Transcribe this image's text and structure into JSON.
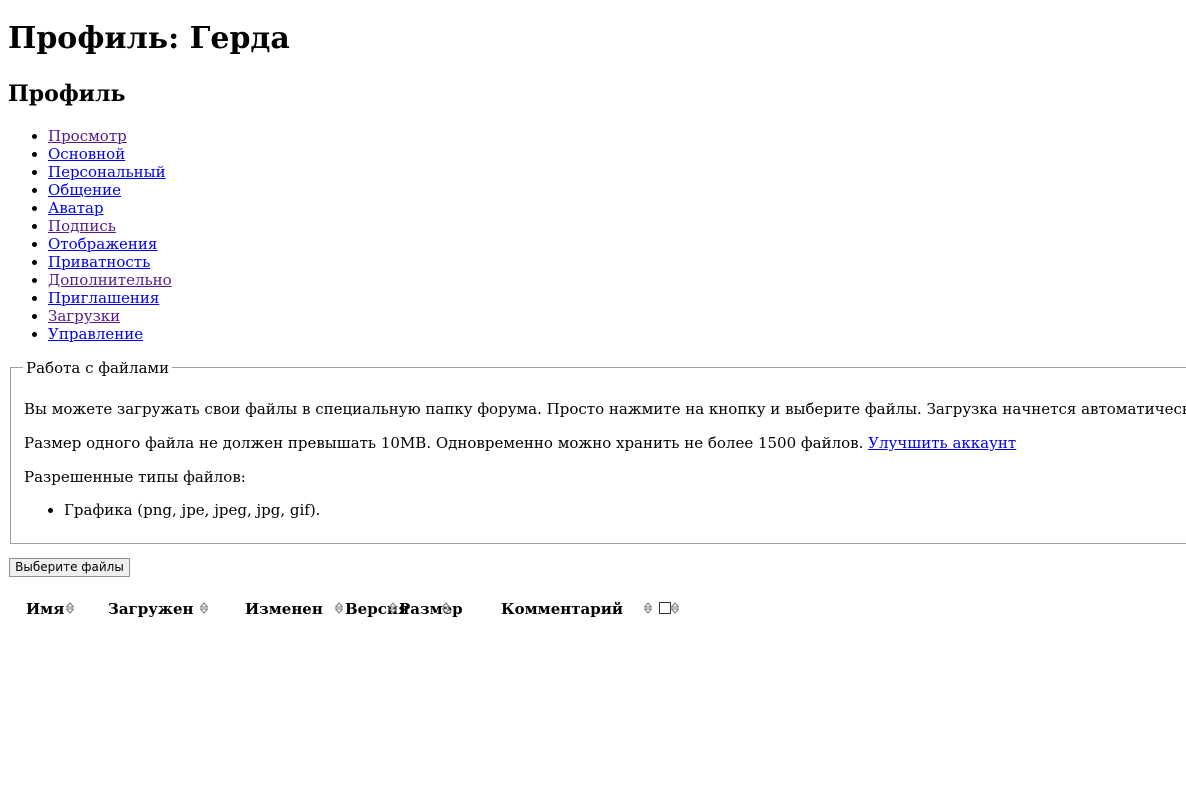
{
  "page": {
    "title": "Профиль: Герда",
    "section_title": "Профиль"
  },
  "nav": {
    "items": [
      {
        "label": "Просмотр",
        "visited": true
      },
      {
        "label": "Основной",
        "visited": false
      },
      {
        "label": "Персональный",
        "visited": false
      },
      {
        "label": "Общение",
        "visited": false
      },
      {
        "label": "Аватар",
        "visited": false
      },
      {
        "label": "Подпись",
        "visited": true
      },
      {
        "label": "Отображения",
        "visited": false
      },
      {
        "label": "Приватность",
        "visited": false
      },
      {
        "label": "Дополнительно",
        "visited": true
      },
      {
        "label": "Приглашения",
        "visited": false
      },
      {
        "label": "Загрузки",
        "visited": true
      },
      {
        "label": "Управление",
        "visited": false
      }
    ]
  },
  "files_panel": {
    "legend": "Работа с файлами",
    "intro": "Вы можете загружать свои файлы в специальную папку форума. Просто нажмите на кнопку и выберите файлы. Загрузка начнется автоматически.",
    "limits": "Размер одного файла не должен превышать 10MB. Одновременно можно хранить не более 1500 файлов.",
    "upgrade_link": "Улучшить аккаунт",
    "allowed_label": "Разрешенные типы файлов:",
    "allowed_types": [
      "Графика (png, jpe, jpeg, jpg, gif)."
    ]
  },
  "upload": {
    "button_label": "Выберите файлы"
  },
  "table": {
    "columns": {
      "name": "Имя",
      "uploaded": "Загружен",
      "modified": "Изменен",
      "version": "Версия",
      "size": "Размер",
      "comment": "Комментарий"
    }
  },
  "colors": {
    "link": "#0000ee",
    "visited_link": "#551a8b",
    "fieldset_border": "#a0a0a0",
    "button_bg": "#efefef"
  }
}
